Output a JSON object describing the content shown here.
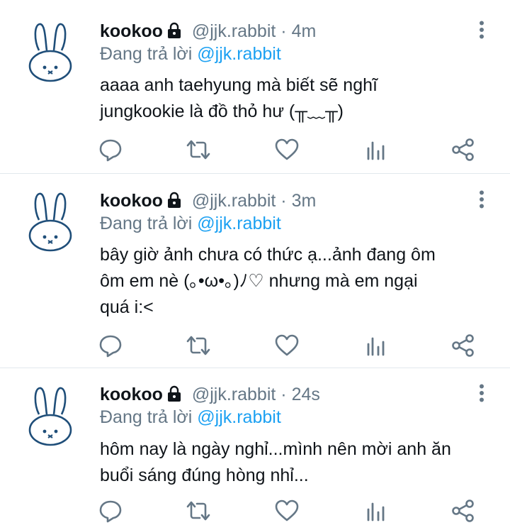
{
  "tweets": [
    {
      "name": "kookoo",
      "handle": "@jjk.rabbit",
      "separator": "·",
      "time": "4m",
      "reply_prefix": "Đang trả lời",
      "reply_to": "@jjk.rabbit",
      "lines": [
        "aaaa anh taehyung mà biết sẽ nghĩ",
        "jungkookie là đồ thỏ hư (╥﹏╥)"
      ]
    },
    {
      "name": "kookoo",
      "handle": "@jjk.rabbit",
      "separator": "·",
      "time": "3m",
      "reply_prefix": "Đang trả lời",
      "reply_to": "@jjk.rabbit",
      "lines": [
        "bây giờ ảnh chưa có thức ạ...ảnh đang ôm",
        "ôm em nè (｡•ω•｡)ﾉ♡ nhưng mà em ngại",
        "quá i:<"
      ]
    },
    {
      "name": "kookoo",
      "handle": "@jjk.rabbit",
      "separator": "·",
      "time": "24s",
      "reply_prefix": "Đang trả lời",
      "reply_to": "@jjk.rabbit",
      "lines": [
        "hôm nay là ngày nghỉ...mình nên mời anh ăn",
        "buổi sáng đúng hòng nhỉ..."
      ]
    }
  ],
  "icons": {
    "avatar": "rabbit-avatar-icon",
    "lock": "lock-icon",
    "more": "more-vertical-icon",
    "reply": "reply-icon",
    "retweet": "retweet-icon",
    "like": "heart-icon",
    "analytics": "analytics-icon",
    "share": "share-icon"
  },
  "colors": {
    "text": "#0f1419",
    "secondary": "#657786",
    "link": "#1da1f2",
    "divider": "#e1e8ed",
    "avatar_stroke": "#1f4e79"
  }
}
